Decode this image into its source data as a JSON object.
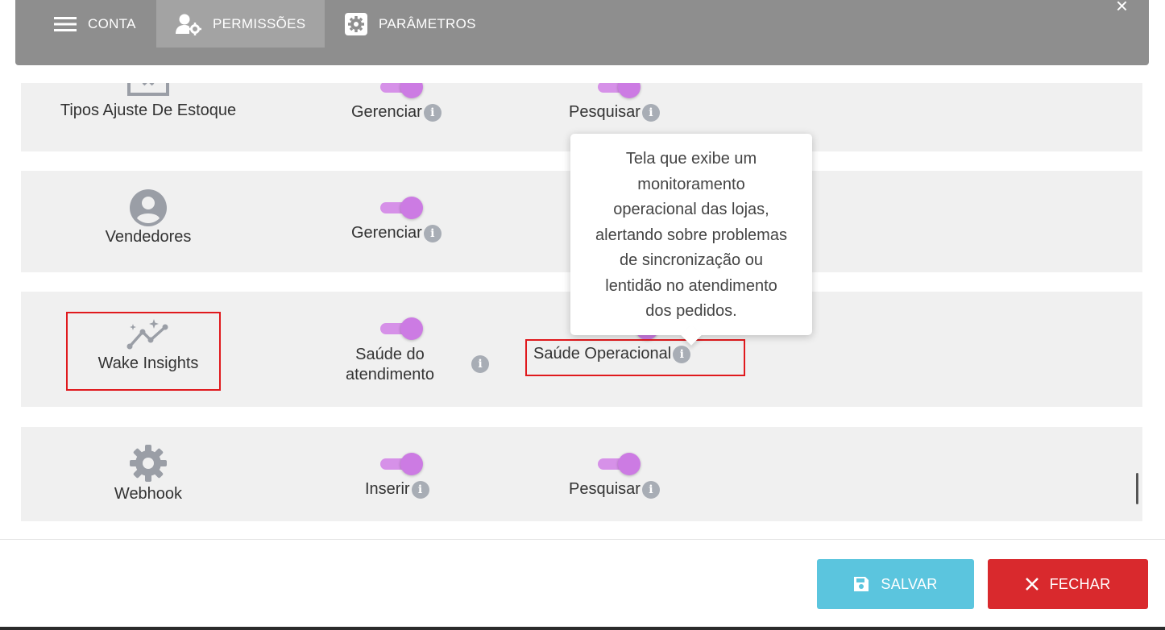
{
  "tabs": [
    {
      "label": "CONTA",
      "icon": "menu-icon"
    },
    {
      "label": "PERMISSÕES",
      "icon": "user-settings-icon"
    },
    {
      "label": "PARÂMETROS",
      "icon": "gear-icon"
    }
  ],
  "close_label": "×",
  "rows": [
    {
      "entity": "Tipos Ajuste De Estoque",
      "icon": "box-x-icon",
      "perms": [
        "Gerenciar",
        "Pesquisar"
      ]
    },
    {
      "entity": "Vendedores",
      "icon": "account-circle-icon",
      "perms": [
        "Gerenciar"
      ]
    },
    {
      "entity": "Wake Insights",
      "icon": "insights-icon",
      "perms": [
        "Saúde do atendimento",
        "Saúde Operacional"
      ]
    },
    {
      "entity": "Webhook",
      "icon": "gear-icon",
      "perms": [
        "Inserir",
        "Pesquisar"
      ]
    }
  ],
  "perm_line1": "Saúde do",
  "perm_line2": "atendimento",
  "tooltip": {
    "lines": [
      "Tela que exibe um",
      "monitoramento",
      "operacional das lojas,",
      "alertando sobre problemas",
      "de sincronização ou",
      "lentidão no atendimento",
      "dos pedidos."
    ]
  },
  "footer": {
    "save_label": "SALVAR",
    "close_label": "FECHAR"
  },
  "colors": {
    "header": "#8e8e8e",
    "active_tab": "#a3a3a3",
    "toggle": "#cc7be3",
    "save": "#5bc5de",
    "close": "#d9292d",
    "highlight": "#e0191d"
  }
}
